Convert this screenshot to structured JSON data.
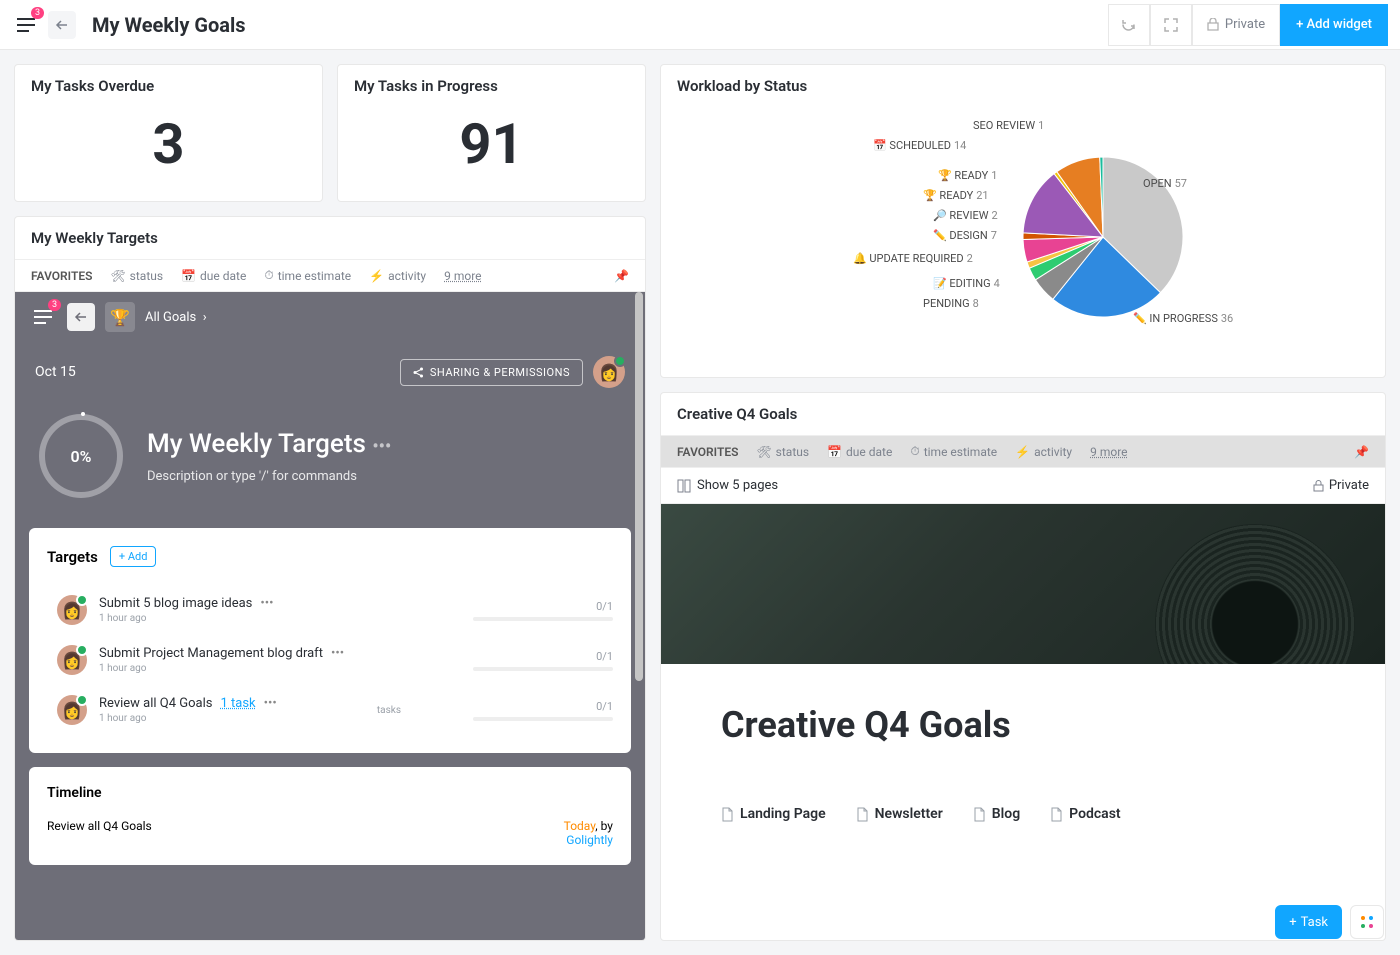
{
  "header": {
    "menu_badge": "3",
    "title": "My Weekly Goals",
    "private_label": "Private",
    "add_widget_label": "+ Add widget"
  },
  "stats": {
    "overdue_label": "My Tasks Overdue",
    "overdue_value": "3",
    "progress_label": "My Tasks in Progress",
    "progress_value": "91"
  },
  "weekly_targets": {
    "title": "My Weekly Targets",
    "filters": {
      "favorites": "FAVORITES",
      "status": "status",
      "due_date": "due date",
      "time_estimate": "time estimate",
      "activity": "activity",
      "more": "9 more"
    },
    "panel": {
      "menu_badge": "3",
      "crumb": "All Goals",
      "date": "Oct 15",
      "sharing_btn": "SHARING & PERMISSIONS",
      "progress": "0%",
      "hero_title": "My Weekly Targets",
      "hero_desc": "Description or type '/' for commands",
      "targets_head": "Targets",
      "add_btn": "+ Add",
      "items": [
        {
          "name": "Submit 5 blog image ideas",
          "time": "1 hour ago",
          "count": "0/1"
        },
        {
          "name": "Submit Project Management blog draft",
          "time": "1 hour ago",
          "count": "0/1"
        },
        {
          "name": "Review all Q4 Goals",
          "link": "1 task",
          "time": "1 hour ago",
          "tasks_label": "tasks",
          "count": "0/1"
        }
      ],
      "timeline_head": "Timeline",
      "timeline_item": "Review all Q4 Goals",
      "timeline_today": "Today",
      "timeline_by": ", by",
      "timeline_user": "Golightly"
    }
  },
  "workload": {
    "title": "Workload by Status"
  },
  "chart_data": {
    "type": "pie",
    "title": "Workload by Status",
    "series": [
      {
        "name": "OPEN",
        "value": 57,
        "color": "#c9c9c9"
      },
      {
        "name": "IN PROGRESS",
        "value": 36,
        "color": "#2f8ae0",
        "icon": "✏️"
      },
      {
        "name": "PENDING",
        "value": 8,
        "color": "#8a8a8a"
      },
      {
        "name": "EDITING",
        "value": 4,
        "color": "#2ecc71",
        "icon": "📝"
      },
      {
        "name": "UPDATE REQUIRED",
        "value": 2,
        "color": "#f6c344",
        "icon": "🔔"
      },
      {
        "name": "DESIGN",
        "value": 7,
        "color": "#e84393",
        "icon": "✏️"
      },
      {
        "name": "REVIEW",
        "value": 2,
        "color": "#d35400",
        "icon": "🔎"
      },
      {
        "name": "READY",
        "value": 21,
        "color": "#9b59b6",
        "icon": "🏆"
      },
      {
        "name": "READY",
        "value": 1,
        "color": "#f1c40f",
        "icon": "🏆"
      },
      {
        "name": "SCHEDULED",
        "value": 14,
        "color": "#e67e22",
        "icon": "📅"
      },
      {
        "name": "SEO REVIEW",
        "value": 1,
        "color": "#1abc9c"
      }
    ]
  },
  "creative": {
    "title": "Creative Q4 Goals",
    "show_pages": "Show 5 pages",
    "private": "Private",
    "hero_title": "Creative Q4 Goals",
    "links": [
      "Landing Page",
      "Newsletter",
      "Blog",
      "Podcast"
    ]
  },
  "float": {
    "task_btn": "Task"
  }
}
